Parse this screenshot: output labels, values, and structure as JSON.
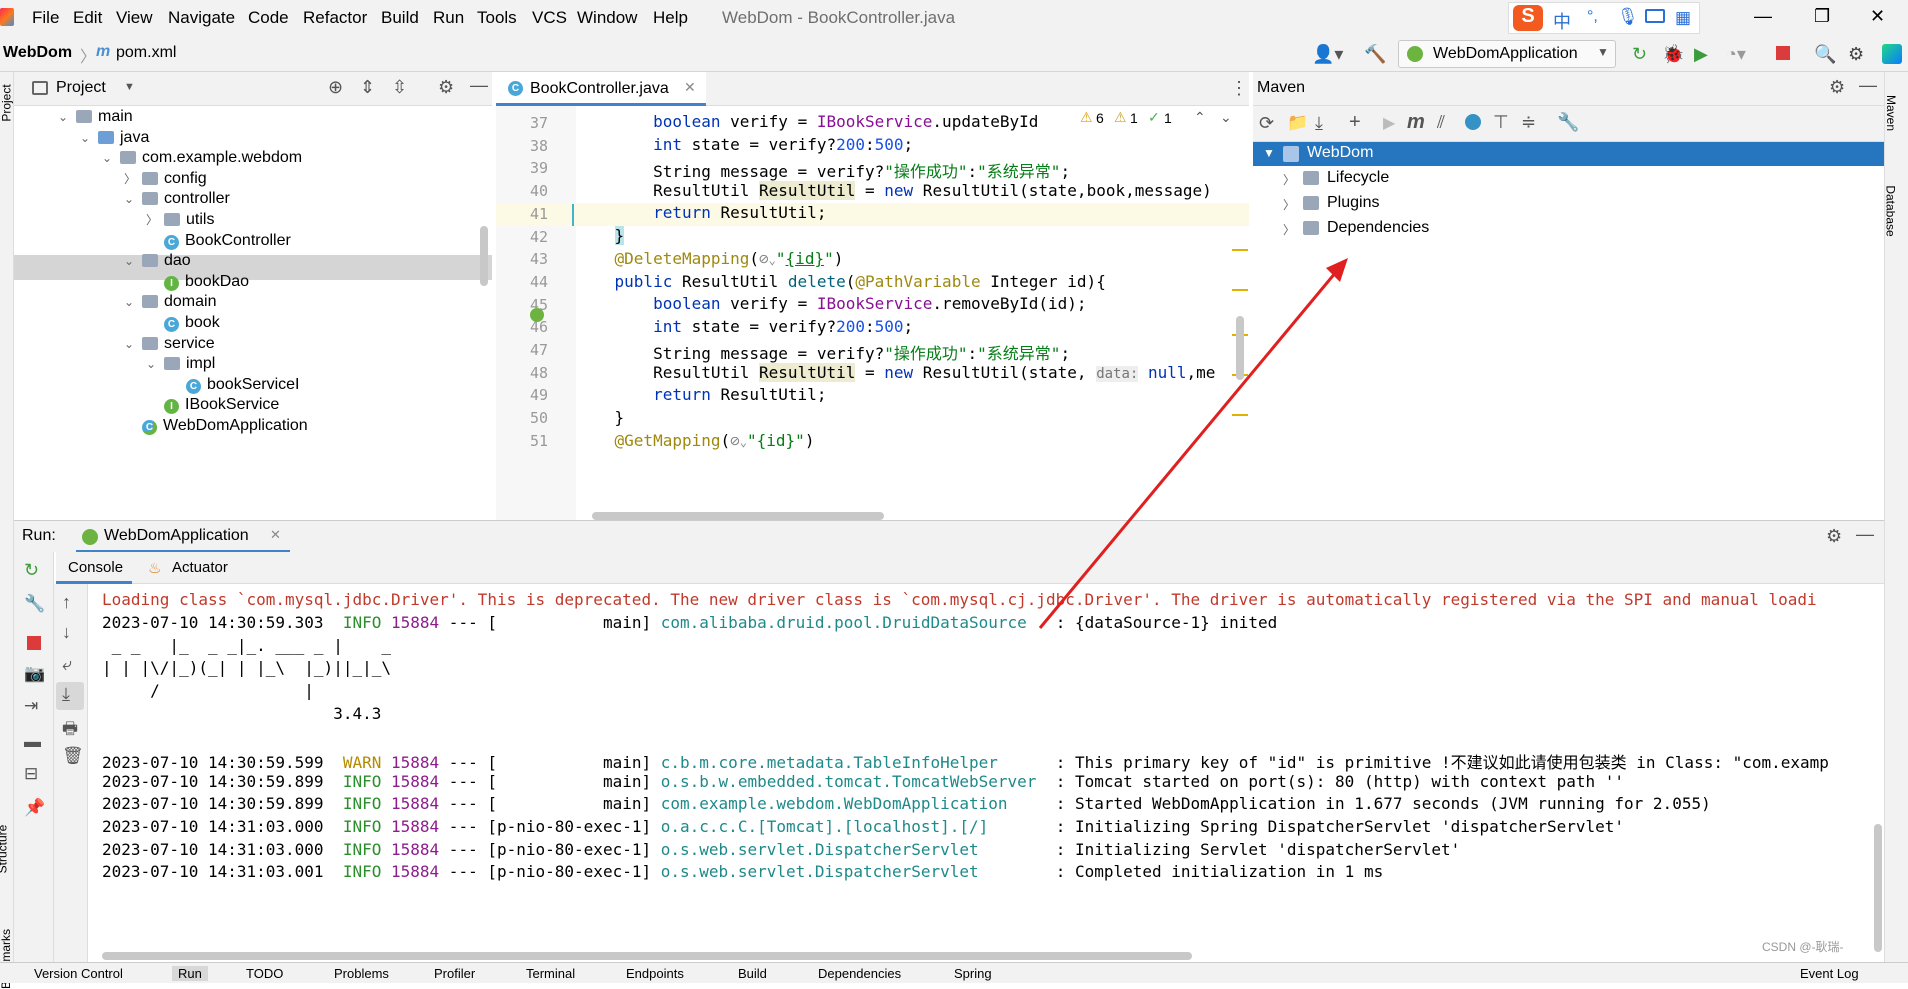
{
  "menubar": {
    "items": [
      "File",
      "Edit",
      "View",
      "Navigate",
      "Code",
      "Refactor",
      "Build",
      "Run",
      "Tools",
      "VCS",
      "Window",
      "Help"
    ],
    "window_title": "WebDom - BookController.java",
    "ime": {
      "logo": "S",
      "lang": "中"
    }
  },
  "navbar": {
    "project": "WebDom",
    "file": "pom.xml",
    "run_config": "WebDomApplication"
  },
  "project_panel": {
    "title": "Project",
    "tree": [
      {
        "label": "main",
        "kind": "folder",
        "depth": 0,
        "open": true
      },
      {
        "label": "java",
        "kind": "folder-src",
        "depth": 1,
        "open": true
      },
      {
        "label": "com.example.webdom",
        "kind": "package",
        "depth": 2,
        "open": true
      },
      {
        "label": "config",
        "kind": "package",
        "depth": 3,
        "open": false
      },
      {
        "label": "controller",
        "kind": "package",
        "depth": 3,
        "open": true
      },
      {
        "label": "utils",
        "kind": "package",
        "depth": 4,
        "open": false
      },
      {
        "label": "BookController",
        "kind": "class",
        "depth": 4,
        "selected": true
      },
      {
        "label": "dao",
        "kind": "package",
        "depth": 3,
        "open": true
      },
      {
        "label": "bookDao",
        "kind": "interface",
        "depth": 4
      },
      {
        "label": "domain",
        "kind": "package",
        "depth": 3,
        "open": true
      },
      {
        "label": "book",
        "kind": "class",
        "depth": 4
      },
      {
        "label": "service",
        "kind": "package",
        "depth": 3,
        "open": true
      },
      {
        "label": "impl",
        "kind": "package",
        "depth": 4,
        "open": true
      },
      {
        "label": "bookServiceI",
        "kind": "class",
        "depth": 5
      },
      {
        "label": "IBookService",
        "kind": "interface",
        "depth": 4
      },
      {
        "label": "WebDomApplication",
        "kind": "spring-class",
        "depth": 3
      }
    ]
  },
  "editor": {
    "tab": "BookController.java",
    "inspections": {
      "warnings": "6",
      "weak_warnings": "1",
      "ok": "1"
    },
    "line_numbers": [
      "37",
      "38",
      "39",
      "40",
      "41",
      "42",
      "43",
      "44",
      "45",
      "46",
      "47",
      "48",
      "49",
      "50",
      "51"
    ],
    "inlay_hint": "data:"
  },
  "maven": {
    "title": "Maven",
    "root": "WebDom",
    "children": [
      "Lifecycle",
      "Plugins",
      "Dependencies"
    ]
  },
  "run": {
    "label": "Run:",
    "config_tab": "WebDomApplication",
    "subtabs": [
      "Console",
      "Actuator"
    ],
    "console": {
      "driver_warning": "Loading class `com.mysql.jdbc.Driver'. This is deprecated. The new driver class is `com.mysql.cj.jdbc.Driver'. The driver is automatically registered via the SPI and manual loadi",
      "banner": [
        " _ _   |_  _ _|_. ___ _ |    _ ",
        "| | |\\/|_)(_| | |_\\  |_)||_|_\\ ",
        "     /               |",
        "                        3.4.3"
      ],
      "logs": [
        {
          "ts": "2023-07-10 14:30:59.303",
          "level": "INFO",
          "pid": "15884",
          "thread": "[           main]",
          "logger": "com.alibaba.druid.pool.DruidDataSource",
          "msg": ": {dataSource-1} inited"
        },
        {
          "ts": "2023-07-10 14:30:59.599",
          "level": "WARN",
          "pid": "15884",
          "thread": "[           main]",
          "logger": "c.b.m.core.metadata.TableInfoHelper",
          "msg": ": This primary key of \"id\" is primitive !不建议如此请使用包装类 in Class: \"com.examp"
        },
        {
          "ts": "2023-07-10 14:30:59.899",
          "level": "INFO",
          "pid": "15884",
          "thread": "[           main]",
          "logger": "o.s.b.w.embedded.tomcat.TomcatWebServer",
          "msg": ": Tomcat started on port(s): 80 (http) with context path ''"
        },
        {
          "ts": "2023-07-10 14:30:59.899",
          "level": "INFO",
          "pid": "15884",
          "thread": "[           main]",
          "logger": "com.example.webdom.WebDomApplication",
          "msg": ": Started WebDomApplication in 1.677 seconds (JVM running for 2.055)"
        },
        {
          "ts": "2023-07-10 14:31:03.000",
          "level": "INFO",
          "pid": "15884",
          "thread": "[p-nio-80-exec-1]",
          "logger": "o.a.c.c.C.[Tomcat].[localhost].[/]",
          "msg": ": Initializing Spring DispatcherServlet 'dispatcherServlet'"
        },
        {
          "ts": "2023-07-10 14:31:03.000",
          "level": "INFO",
          "pid": "15884",
          "thread": "[p-nio-80-exec-1]",
          "logger": "o.s.web.servlet.DispatcherServlet",
          "msg": ": Initializing Servlet 'dispatcherServlet'"
        },
        {
          "ts": "2023-07-10 14:31:03.001",
          "level": "INFO",
          "pid": "15884",
          "thread": "[p-nio-80-exec-1]",
          "logger": "o.s.web.servlet.DispatcherServlet",
          "msg": ": Completed initialization in 1 ms"
        }
      ]
    }
  },
  "side_tabs": {
    "left_top": "Project",
    "left_mid": "Structure",
    "left_bot": "Bookmarks",
    "right_top": "Maven",
    "right_mid": "Database"
  },
  "bottom_bar": [
    "Version Control",
    "Run",
    "TODO",
    "Problems",
    "Profiler",
    "Terminal",
    "Endpoints",
    "Build",
    "Dependencies",
    "Spring",
    "Event Log"
  ],
  "watermark": "CSDN @-耿瑞-",
  "colors": {
    "selection": "#2675bf",
    "arrow": "#e02020",
    "accent": "#3592c4"
  }
}
